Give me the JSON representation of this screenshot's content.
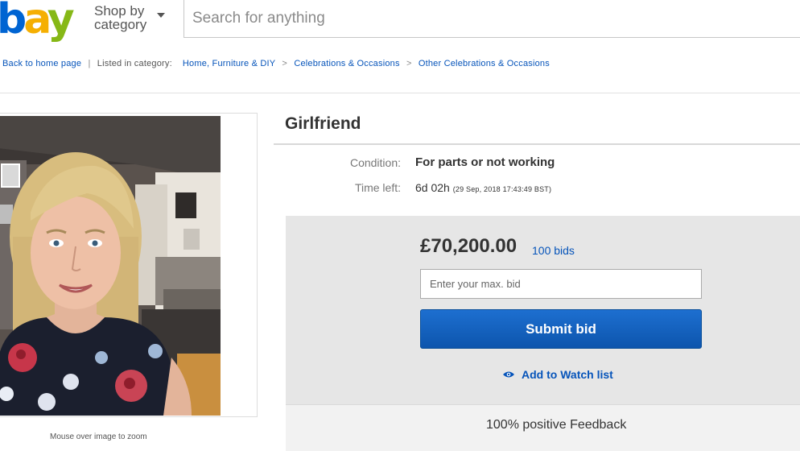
{
  "header": {
    "logo": {
      "b": "b",
      "a": "a",
      "y": "y"
    },
    "shop_by_line1": "Shop by",
    "shop_by_line2": "category",
    "search_placeholder": "Search for anything"
  },
  "breadcrumb": {
    "back": "Back to home page",
    "listed_in": "Listed in category:",
    "categories": [
      "Home, Furniture & DIY",
      "Celebrations & Occasions",
      "Other Celebrations & Occasions"
    ],
    "separator": ">"
  },
  "photo": {
    "caption": "Mouse over image to zoom"
  },
  "item": {
    "title": "Girlfriend",
    "condition_label": "Condition:",
    "condition_value": "For parts or not working",
    "time_left_label": "Time left:",
    "time_left_value": "6d 02h",
    "time_left_detail": "(29 Sep, 2018  17:43:49 BST)"
  },
  "bid": {
    "price": "£70,200.00",
    "bids_count": "100 bids",
    "max_bid_placeholder": "Enter your max. bid",
    "submit_label": "Submit bid",
    "watch_label": "Add to Watch list",
    "feedback": "100% positive Feedback"
  },
  "colors": {
    "ebay_blue": "#0064d2",
    "ebay_yellow": "#f5af02",
    "ebay_green": "#86b817",
    "link_blue": "#0654ba",
    "button_blue": "#1d6fd0"
  }
}
